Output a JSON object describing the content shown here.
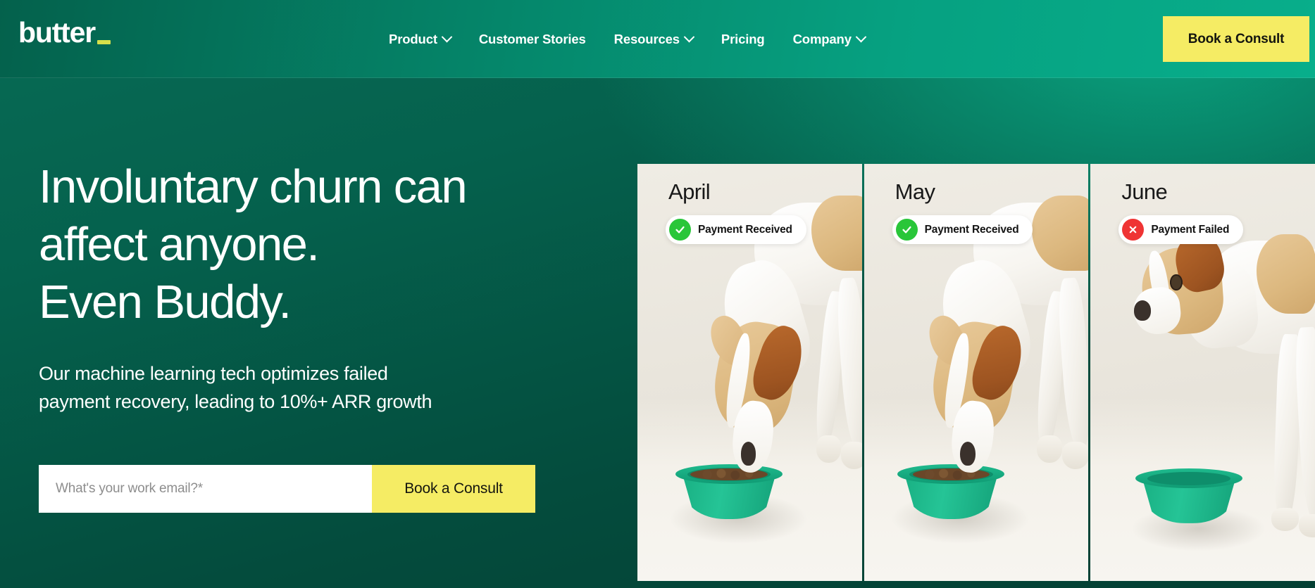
{
  "brand": {
    "logo_text": "butter",
    "logo_accent_color": "#d7e04a"
  },
  "header": {
    "nav": [
      {
        "label": "Product",
        "has_dropdown": true
      },
      {
        "label": "Customer Stories",
        "has_dropdown": false
      },
      {
        "label": "Resources",
        "has_dropdown": true
      },
      {
        "label": "Pricing",
        "has_dropdown": false
      },
      {
        "label": "Company",
        "has_dropdown": true
      }
    ],
    "cta_label": "Book a Consult",
    "cta_color": "#f5ec64",
    "background_color": "#06a181"
  },
  "hero": {
    "title_line_1": "Involuntary churn can",
    "title_line_2": "affect anyone.",
    "title_line_3": "Even Buddy.",
    "sub_line_1": "Our machine learning tech optimizes failed",
    "sub_line_2": "payment recovery, leading to 10%+ ARR growth",
    "form": {
      "email_placeholder": "What's your work email?*",
      "email_value": "",
      "submit_label": "Book a Consult"
    }
  },
  "panels": [
    {
      "month": "April",
      "status_label": "Payment Received",
      "status_type": "success",
      "status_color": "#29c639",
      "status_icon": "check-icon",
      "scene": "dog-eating-from-bowl"
    },
    {
      "month": "May",
      "status_label": "Payment Received",
      "status_type": "success",
      "status_color": "#29c639",
      "status_icon": "check-icon",
      "scene": "dog-eating-from-bowl"
    },
    {
      "month": "June",
      "status_label": "Payment Failed",
      "status_type": "error",
      "status_color": "#ef3434",
      "status_icon": "x-icon",
      "scene": "dog-standing-empty-bowl"
    }
  ]
}
